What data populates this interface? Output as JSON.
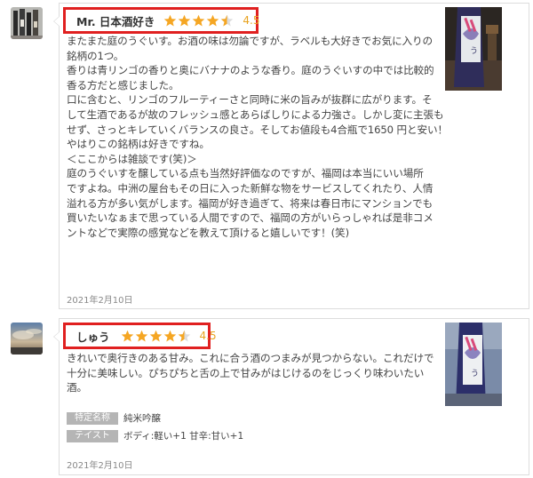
{
  "reviews": [
    {
      "reviewer": "Mr. 日本酒好き",
      "score": "4.5",
      "rating": 4.5,
      "lines": [
        "またまた庭のうぐいす。お酒の味は勿論ですが、ラベルも大好きでお気に入りの",
        "銘柄の1つ。",
        "香りは青リンゴの香りと奥にバナナのような香り。庭のうぐいすの中では比較的",
        "香る方だと感じました。",
        "口に含むと、リンゴのフルーティーさと同時に米の旨みが抜群に広がります。そ",
        "して生酒であるが故のフレッシュ感とあらばしりによる力強さ。しかし変に主張も",
        "せず、さっとキレていくバランスの良さ。そしてお値段も4合瓶で1650 円と安い！",
        "やはりこの銘柄は好きですね。",
        "＜ここからは雑談です(笑)＞",
        "庭のうぐいすを醸している点も当然好評価なのですが、福岡は本当にいい場所",
        "ですよね。中洲の屋台もその日に入った新鮮な物をサービスしてくれたり、人情",
        "溢れる方が多い気がします。福岡が好き過ぎて、将来は春日市にマンションでも",
        "買いたいなぁまで思っている人間ですので、福岡の方がいらっしゃれば是非コメ",
        "ントなどで実際の感覚などを教えて頂けると嬉しいです！(笑)"
      ],
      "date": "2021年2月10日"
    },
    {
      "reviewer": "しゅう",
      "score": "4.5",
      "rating": 4.5,
      "lines": [
        "きれいで奥行きのある甘み。これに合う酒のつまみが見つからない。これだけで",
        "十分に美味しい。ぴちぴちと舌の上で甘みがはじけるのをじっくり味わいたい",
        "酒。"
      ],
      "specs": [
        {
          "label": "特定名称",
          "value": "純米吟醸"
        },
        {
          "label": "テイスト",
          "value": "ボディ:軽い+1  甘辛:甘い+1"
        }
      ],
      "date": "2021年2月10日"
    }
  ],
  "colors": {
    "accent_red": "#e02020",
    "star": "#f5a623",
    "score": "#e8a320",
    "label_bg": "#b5b5b5"
  }
}
